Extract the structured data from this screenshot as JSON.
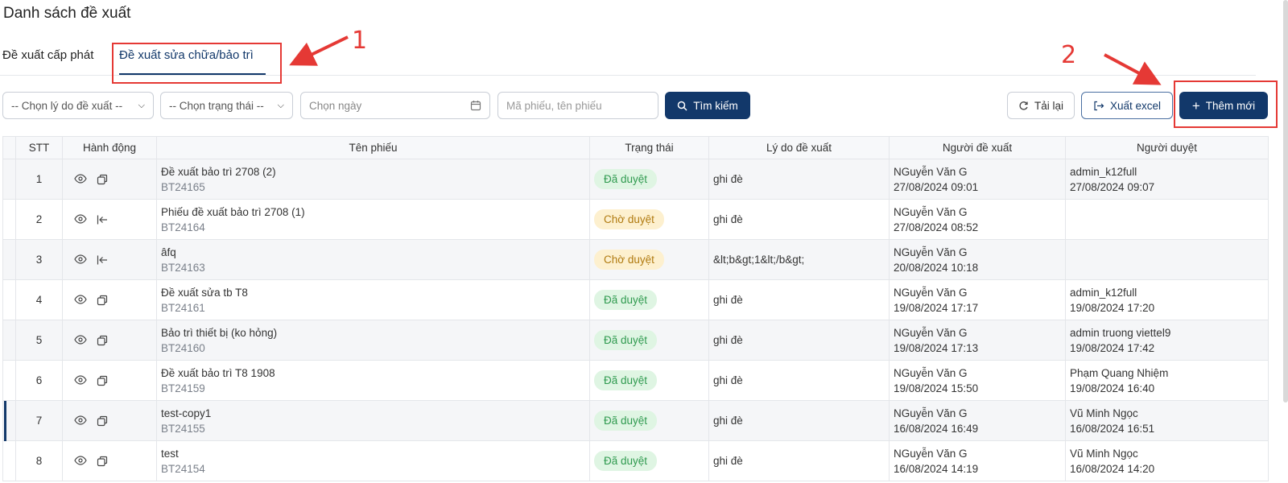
{
  "page": {
    "title": "Danh sách đề xuất"
  },
  "tabs": [
    {
      "label": "Đề xuất cấp phát",
      "active": false
    },
    {
      "label": "Đề xuất sửa chữa/bảo trì",
      "active": true
    }
  ],
  "annotations": {
    "marker_1": "1",
    "marker_2": "2"
  },
  "filters": {
    "reason_select": "-- Chọn lý do đề xuất --",
    "status_select": "-- Chọn trạng thái --",
    "date_placeholder": "Chọn ngày",
    "search_placeholder": "Mã phiếu, tên phiếu",
    "search_button": "Tìm kiếm"
  },
  "actions": {
    "reload": "Tải lại",
    "export": "Xuất excel",
    "add": "Thêm mới"
  },
  "table": {
    "headers": {
      "stt": "STT",
      "action": "Hành động",
      "name": "Tên phiếu",
      "status": "Trạng thái",
      "reason": "Lý do đề xuất",
      "proposer": "Người đề xuất",
      "approver": "Người duyệt"
    },
    "rows": [
      {
        "stt": "1",
        "name": "Đề xuất bảo trì 2708 (2)",
        "code": "BT24165",
        "status": "Đã duyệt",
        "reason": "ghi đè",
        "proposer": "NGuyễn Văn G",
        "proposer_time": "27/08/2024 09:01",
        "approver": "admin_k12full",
        "approver_time": "27/08/2024 09:07"
      },
      {
        "stt": "2",
        "name": "Phiếu đề xuất bảo trì 2708 (1)",
        "code": "BT24164",
        "status": "Chờ duyệt",
        "reason": "ghi đè",
        "proposer": "NGuyễn Văn G",
        "proposer_time": "27/08/2024 08:52",
        "approver": "",
        "approver_time": ""
      },
      {
        "stt": "3",
        "name": "âfq",
        "code": "BT24163",
        "status": "Chờ duyệt",
        "reason": "&lt;b&gt;1&lt;/b&gt;",
        "proposer": "NGuyễn Văn G",
        "proposer_time": "20/08/2024 10:18",
        "approver": "",
        "approver_time": ""
      },
      {
        "stt": "4",
        "name": "Đề xuất sửa tb T8",
        "code": "BT24161",
        "status": "Đã duyệt",
        "reason": "ghi đè",
        "proposer": "NGuyễn Văn G",
        "proposer_time": "19/08/2024 17:17",
        "approver": "admin_k12full",
        "approver_time": "19/08/2024 17:20"
      },
      {
        "stt": "5",
        "name": "Bảo trì thiết bị (ko hỏng)",
        "code": "BT24160",
        "status": "Đã duyệt",
        "reason": "ghi đè",
        "proposer": "NGuyễn Văn G",
        "proposer_time": "19/08/2024 17:13",
        "approver": "admin truong viettel9",
        "approver_time": "19/08/2024 17:42"
      },
      {
        "stt": "6",
        "name": "Đề xuất bảo trì T8 1908",
        "code": "BT24159",
        "status": "Đã duyệt",
        "reason": "ghi đè",
        "proposer": "NGuyễn Văn G",
        "proposer_time": "19/08/2024 15:50",
        "approver": "Phạm Quang Nhiệm",
        "approver_time": "19/08/2024 16:40"
      },
      {
        "stt": "7",
        "name": "test-copy1",
        "code": "BT24155",
        "status": "Đã duyệt",
        "reason": "ghi đè",
        "proposer": "NGuyễn Văn G",
        "proposer_time": "16/08/2024 16:49",
        "approver": "Vũ Minh Ngọc",
        "approver_time": "16/08/2024 16:51"
      },
      {
        "stt": "8",
        "name": "test",
        "code": "BT24154",
        "status": "Đã duyệt",
        "reason": "ghi đè",
        "proposer": "NGuyễn Văn G",
        "proposer_time": "16/08/2024 14:19",
        "approver": "Vũ Minh Ngọc",
        "approver_time": "16/08/2024 14:20"
      }
    ]
  },
  "colors": {
    "primary": "#12386a",
    "annotation": "#e53935",
    "approved_bg": "#dff5e3",
    "pending_bg": "#fdf0cf"
  }
}
